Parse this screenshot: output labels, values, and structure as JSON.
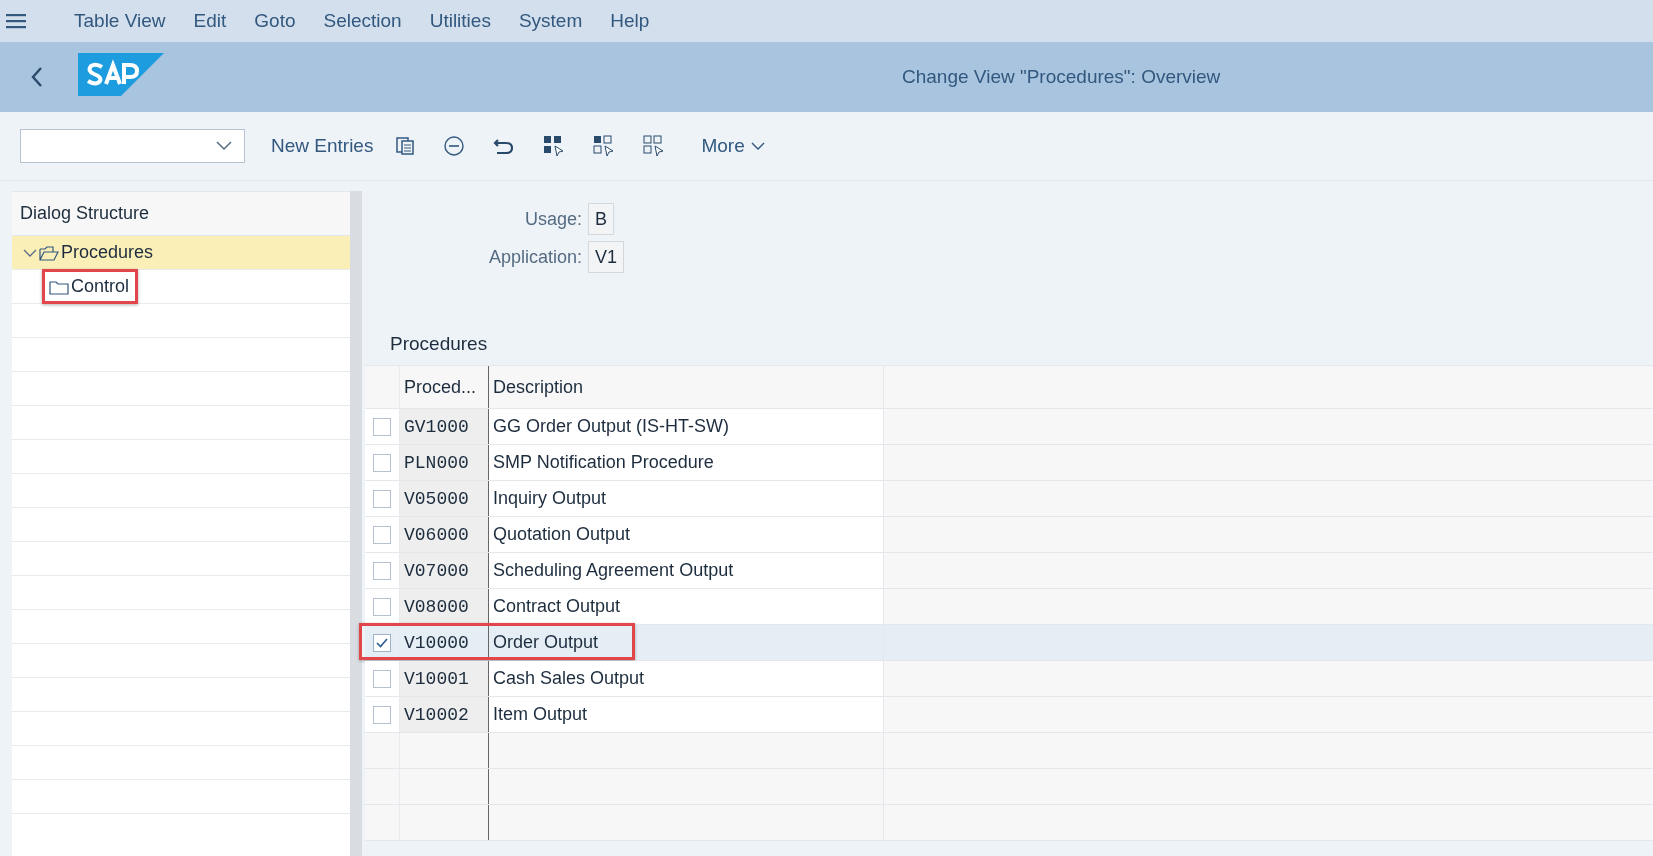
{
  "menu_bar": {
    "items": [
      "Table View",
      "Edit",
      "Goto",
      "Selection",
      "Utilities",
      "System",
      "Help"
    ]
  },
  "header": {
    "title": "Change View \"Procedures\": Overview"
  },
  "toolbar": {
    "buttons": [
      "New Entries"
    ],
    "more": "More"
  },
  "dialog_structure": {
    "title": "Dialog Structure",
    "tree": [
      {
        "label": "Procedures",
        "expanded": true,
        "selected": true,
        "highlighted": false,
        "children": [
          {
            "label": "Control",
            "selected": false,
            "highlighted": true
          }
        ]
      }
    ]
  },
  "fields": [
    {
      "label": "Usage:",
      "value": "B"
    },
    {
      "label": "Application:",
      "value": "V1"
    }
  ],
  "table": {
    "title": "Procedures",
    "columns": [
      "Proced...",
      "Description"
    ],
    "rows": [
      {
        "procedure": "GV1000",
        "description": "GG Order Output (IS-HT-SW)",
        "checked": false,
        "selected": false,
        "highlighted": false
      },
      {
        "procedure": "PLN000",
        "description": "SMP Notification Procedure",
        "checked": false,
        "selected": false,
        "highlighted": false
      },
      {
        "procedure": "V05000",
        "description": "Inquiry Output",
        "checked": false,
        "selected": false,
        "highlighted": false
      },
      {
        "procedure": "V06000",
        "description": "Quotation Output",
        "checked": false,
        "selected": false,
        "highlighted": false
      },
      {
        "procedure": "V07000",
        "description": "Scheduling Agreement Output",
        "checked": false,
        "selected": false,
        "highlighted": false
      },
      {
        "procedure": "V08000",
        "description": "Contract Output",
        "checked": false,
        "selected": false,
        "highlighted": false
      },
      {
        "procedure": "V10000",
        "description": "Order Output",
        "checked": true,
        "selected": true,
        "highlighted": true
      },
      {
        "procedure": "V10001",
        "description": "Cash Sales Output",
        "checked": false,
        "selected": false,
        "highlighted": false
      },
      {
        "procedure": "V10002",
        "description": "Item Output",
        "checked": false,
        "selected": false,
        "highlighted": false
      }
    ]
  }
}
